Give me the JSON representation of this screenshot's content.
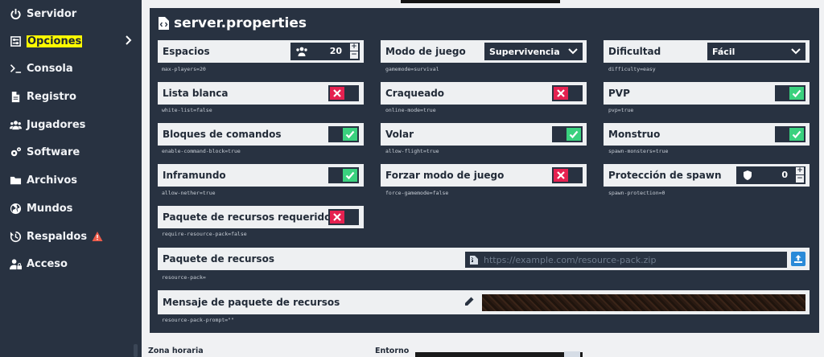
{
  "sidebar": {
    "items": [
      {
        "label": "Servidor",
        "icon": "power-icon"
      },
      {
        "label": "Opciones",
        "icon": "sliders-icon",
        "highlight": "#fffb00"
      },
      {
        "label": "Consola",
        "icon": "terminal-icon"
      },
      {
        "label": "Registro",
        "icon": "file-icon"
      },
      {
        "label": "Jugadores",
        "icon": "users-icon"
      },
      {
        "label": "Software",
        "icon": "cogs-icon"
      },
      {
        "label": "Archivos",
        "icon": "folder-icon"
      },
      {
        "label": "Mundos",
        "icon": "globe-icon"
      },
      {
        "label": "Respaldos",
        "icon": "history-icon",
        "badge": "warning-icon"
      },
      {
        "label": "Acceso",
        "icon": "user-lock-icon"
      }
    ]
  },
  "panel": {
    "title": "server.properties",
    "settings": {
      "max_players": {
        "label": "Espacios",
        "value": "20",
        "hint": "max-players=20"
      },
      "gamemode": {
        "label": "Modo de juego",
        "value": "Supervivencia",
        "hint": "gamemode=survival"
      },
      "difficulty": {
        "label": "Dificultad",
        "value": "Fácil",
        "hint": "difficulty=easy"
      },
      "white_list": {
        "label": "Lista blanca",
        "on": false,
        "hint": "white-list=false"
      },
      "online_mode": {
        "label": "Craqueado",
        "on": false,
        "hint": "online-mode=true"
      },
      "pvp": {
        "label": "PVP",
        "on": true,
        "hint": "pvp=true"
      },
      "command_block": {
        "label": "Bloques de comandos",
        "on": true,
        "hint": "enable-command-block=true"
      },
      "allow_flight": {
        "label": "Volar",
        "on": true,
        "hint": "allow-flight=true"
      },
      "spawn_monsters": {
        "label": "Monstruo",
        "on": true,
        "hint": "spawn-monsters=true"
      },
      "allow_nether": {
        "label": "Inframundo",
        "on": true,
        "hint": "allow-nether=true"
      },
      "force_gamemode": {
        "label": "Forzar modo de juego",
        "on": false,
        "hint": "force-gamemode=false"
      },
      "spawn_protection": {
        "label": "Protección de spawn",
        "value": "0",
        "hint": "spawn-protection=0"
      },
      "require_pack": {
        "label": "Paquete de recursos requerido",
        "on": false,
        "hint": "require-resource-pack=false"
      },
      "resource_pack": {
        "label": "Paquete de recursos",
        "placeholder": "https://example.com/resource-pack.zip",
        "hint": "resource-pack="
      },
      "resource_pack_prompt": {
        "label": "Mensaje de paquete de recursos",
        "hint": "resource-pack-prompt=\"\""
      }
    },
    "plus": "+",
    "minus": "−"
  },
  "below": {
    "timezone_label": "Zona horaria",
    "env_label": "Entorno"
  },
  "colors": {
    "sidebar_bg": "#283241",
    "toggle_on": "#3ad17e",
    "toggle_off": "#e52150",
    "highlight": "#fffb00",
    "upload": "#2a8ad8"
  }
}
